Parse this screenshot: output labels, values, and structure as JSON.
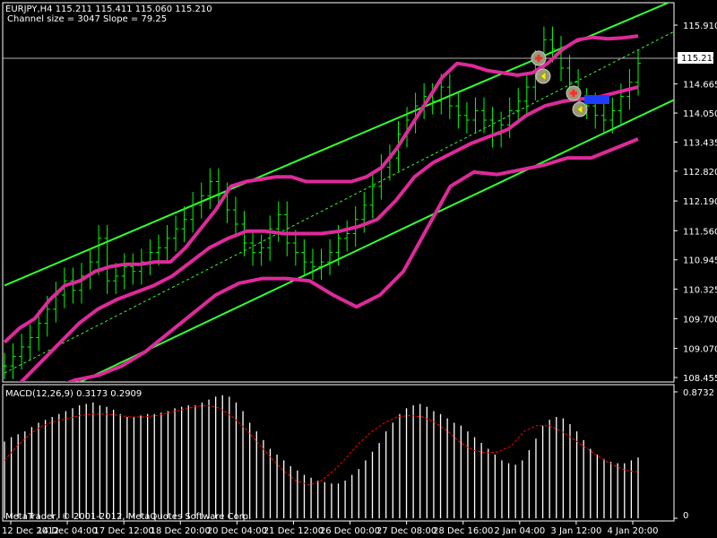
{
  "header": {
    "symbol_info": "EURJPY,H4  115.211 115.411 115.060 115.210",
    "channel_info": "Channel size = 3047 Slope = 79.25"
  },
  "price_badge": "115.210",
  "macd_label": "MACD(12,26,9) 0.3173 0.2909",
  "footer": "MetaTrader, © 2001-2012, MetaQuotes Software Corp.",
  "colors": {
    "background": "#000000",
    "bars": "#00ff00",
    "channel": "#33ff33",
    "bands": "#dd2a9a",
    "macd_hist": "#ffffff",
    "macd_signal": "#ff0000",
    "grid_frame": "#ffffff"
  },
  "chart_data": [
    {
      "type": "line",
      "title": "EURJPY,H4",
      "x_tick_labels": [
        "12 Dec 2012",
        "14 Dec 04:00",
        "17 Dec 12:00",
        "18 Dec 20:00",
        "20 Dec 04:00",
        "21 Dec 12:00",
        "26 Dec 00:00",
        "27 Dec 08:00",
        "28 Dec 16:00",
        "2 Jan 04:00",
        "3 Jan 12:00",
        "4 Jan 20:00"
      ],
      "y_tick_labels": [
        "115.910",
        "115.210",
        "114.665",
        "114.050",
        "113.435",
        "112.820",
        "112.190",
        "111.560",
        "110.945",
        "110.325",
        "109.700",
        "109.070",
        "108.455"
      ],
      "ylim": [
        108.455,
        115.91
      ],
      "close": [
        108.7,
        108.9,
        109.1,
        109.3,
        109.6,
        109.9,
        110.2,
        110.5,
        110.3,
        110.6,
        110.9,
        111.4,
        110.5,
        110.6,
        110.8,
        110.7,
        110.9,
        111.1,
        111.2,
        111.4,
        111.6,
        111.8,
        112.1,
        112.3,
        112.6,
        112.3,
        112.0,
        111.7,
        111.3,
        111.1,
        111.2,
        111.6,
        111.9,
        111.3,
        111.1,
        110.9,
        110.8,
        110.9,
        111.1,
        111.4,
        111.5,
        111.8,
        112.1,
        112.5,
        112.9,
        113.1,
        113.6,
        113.9,
        114.2,
        114.4,
        114.3,
        114.6,
        114.2,
        114.0,
        113.9,
        114.1,
        113.9,
        113.6,
        113.8,
        114.1,
        114.3,
        114.6,
        115.1,
        115.6,
        115.4,
        115.0,
        114.7,
        114.3,
        114.2,
        114.0,
        113.9,
        114.1,
        114.4,
        114.7,
        115.1
      ],
      "upper_band": [
        109.2,
        109.5,
        109.7,
        110.1,
        110.4,
        110.5,
        110.7,
        110.8,
        110.85,
        110.85,
        110.9,
        110.9,
        111.2,
        111.6,
        112.0,
        112.5,
        112.6,
        112.65,
        112.7,
        112.7,
        112.6,
        112.6,
        112.6,
        112.6,
        112.7,
        112.9,
        113.3,
        113.8,
        114.3,
        114.8,
        115.1,
        115.05,
        114.95,
        114.9,
        114.85,
        114.9,
        115.1,
        115.4,
        115.6,
        115.65,
        115.62,
        115.64,
        115.68
      ],
      "middle_band": [
        108.0,
        108.4,
        108.8,
        109.2,
        109.6,
        109.9,
        110.1,
        110.25,
        110.4,
        110.6,
        110.9,
        111.2,
        111.4,
        111.55,
        111.55,
        111.5,
        111.5,
        111.5,
        111.55,
        111.65,
        111.8,
        112.2,
        112.7,
        113.0,
        113.2,
        113.4,
        113.55,
        113.7,
        114.0,
        114.2,
        114.3,
        114.35,
        114.4,
        114.5,
        114.6
      ],
      "lower_band": [
        107.6,
        107.9,
        108.2,
        108.4,
        108.5,
        108.7,
        109.0,
        109.4,
        109.8,
        110.2,
        110.45,
        110.55,
        110.55,
        110.5,
        110.2,
        109.95,
        110.2,
        110.7,
        111.6,
        112.5,
        112.8,
        112.75,
        112.85,
        112.95,
        113.1,
        113.1,
        113.3,
        113.5
      ],
      "channel_lines": {
        "upper_start": 110.4,
        "upper_end": 116.5,
        "lower_start": 107.6,
        "lower_end": 114.4
      },
      "channel_mid": {
        "start": 108.55,
        "end": 115.85
      }
    },
    {
      "type": "bar",
      "title": "MACD(12,26,9)",
      "y_tick_labels": [
        "0.8732",
        "0"
      ],
      "ylim": [
        0,
        0.8732
      ],
      "macd": [
        0.53,
        0.56,
        0.58,
        0.6,
        0.63,
        0.66,
        0.68,
        0.7,
        0.72,
        0.74,
        0.76,
        0.78,
        0.79,
        0.8,
        0.78,
        0.77,
        0.75,
        0.72,
        0.7,
        0.7,
        0.71,
        0.72,
        0.72,
        0.73,
        0.74,
        0.76,
        0.77,
        0.78,
        0.78,
        0.8,
        0.82,
        0.84,
        0.85,
        0.84,
        0.8,
        0.74,
        0.66,
        0.6,
        0.54,
        0.48,
        0.44,
        0.4,
        0.36,
        0.33,
        0.3,
        0.28,
        0.26,
        0.25,
        0.24,
        0.24,
        0.26,
        0.3,
        0.34,
        0.4,
        0.46,
        0.52,
        0.6,
        0.66,
        0.72,
        0.76,
        0.78,
        0.79,
        0.77,
        0.74,
        0.72,
        0.69,
        0.66,
        0.64,
        0.6,
        0.56,
        0.52,
        0.48,
        0.44,
        0.4,
        0.38,
        0.37,
        0.4,
        0.47,
        0.55,
        0.64,
        0.68,
        0.7,
        0.69,
        0.65,
        0.6,
        0.54,
        0.48,
        0.44,
        0.41,
        0.39,
        0.38,
        0.38,
        0.4,
        0.42
      ],
      "signal": [
        0.4,
        0.5,
        0.58,
        0.64,
        0.67,
        0.69,
        0.71,
        0.72,
        0.72,
        0.71,
        0.7,
        0.7,
        0.71,
        0.73,
        0.75,
        0.77,
        0.78,
        0.76,
        0.7,
        0.62,
        0.52,
        0.42,
        0.33,
        0.26,
        0.23,
        0.26,
        0.33,
        0.42,
        0.52,
        0.6,
        0.66,
        0.7,
        0.71,
        0.7,
        0.66,
        0.6,
        0.52,
        0.47,
        0.45,
        0.46,
        0.5,
        0.6,
        0.64,
        0.64,
        0.6,
        0.54,
        0.48,
        0.42,
        0.37,
        0.33,
        0.32
      ]
    }
  ]
}
